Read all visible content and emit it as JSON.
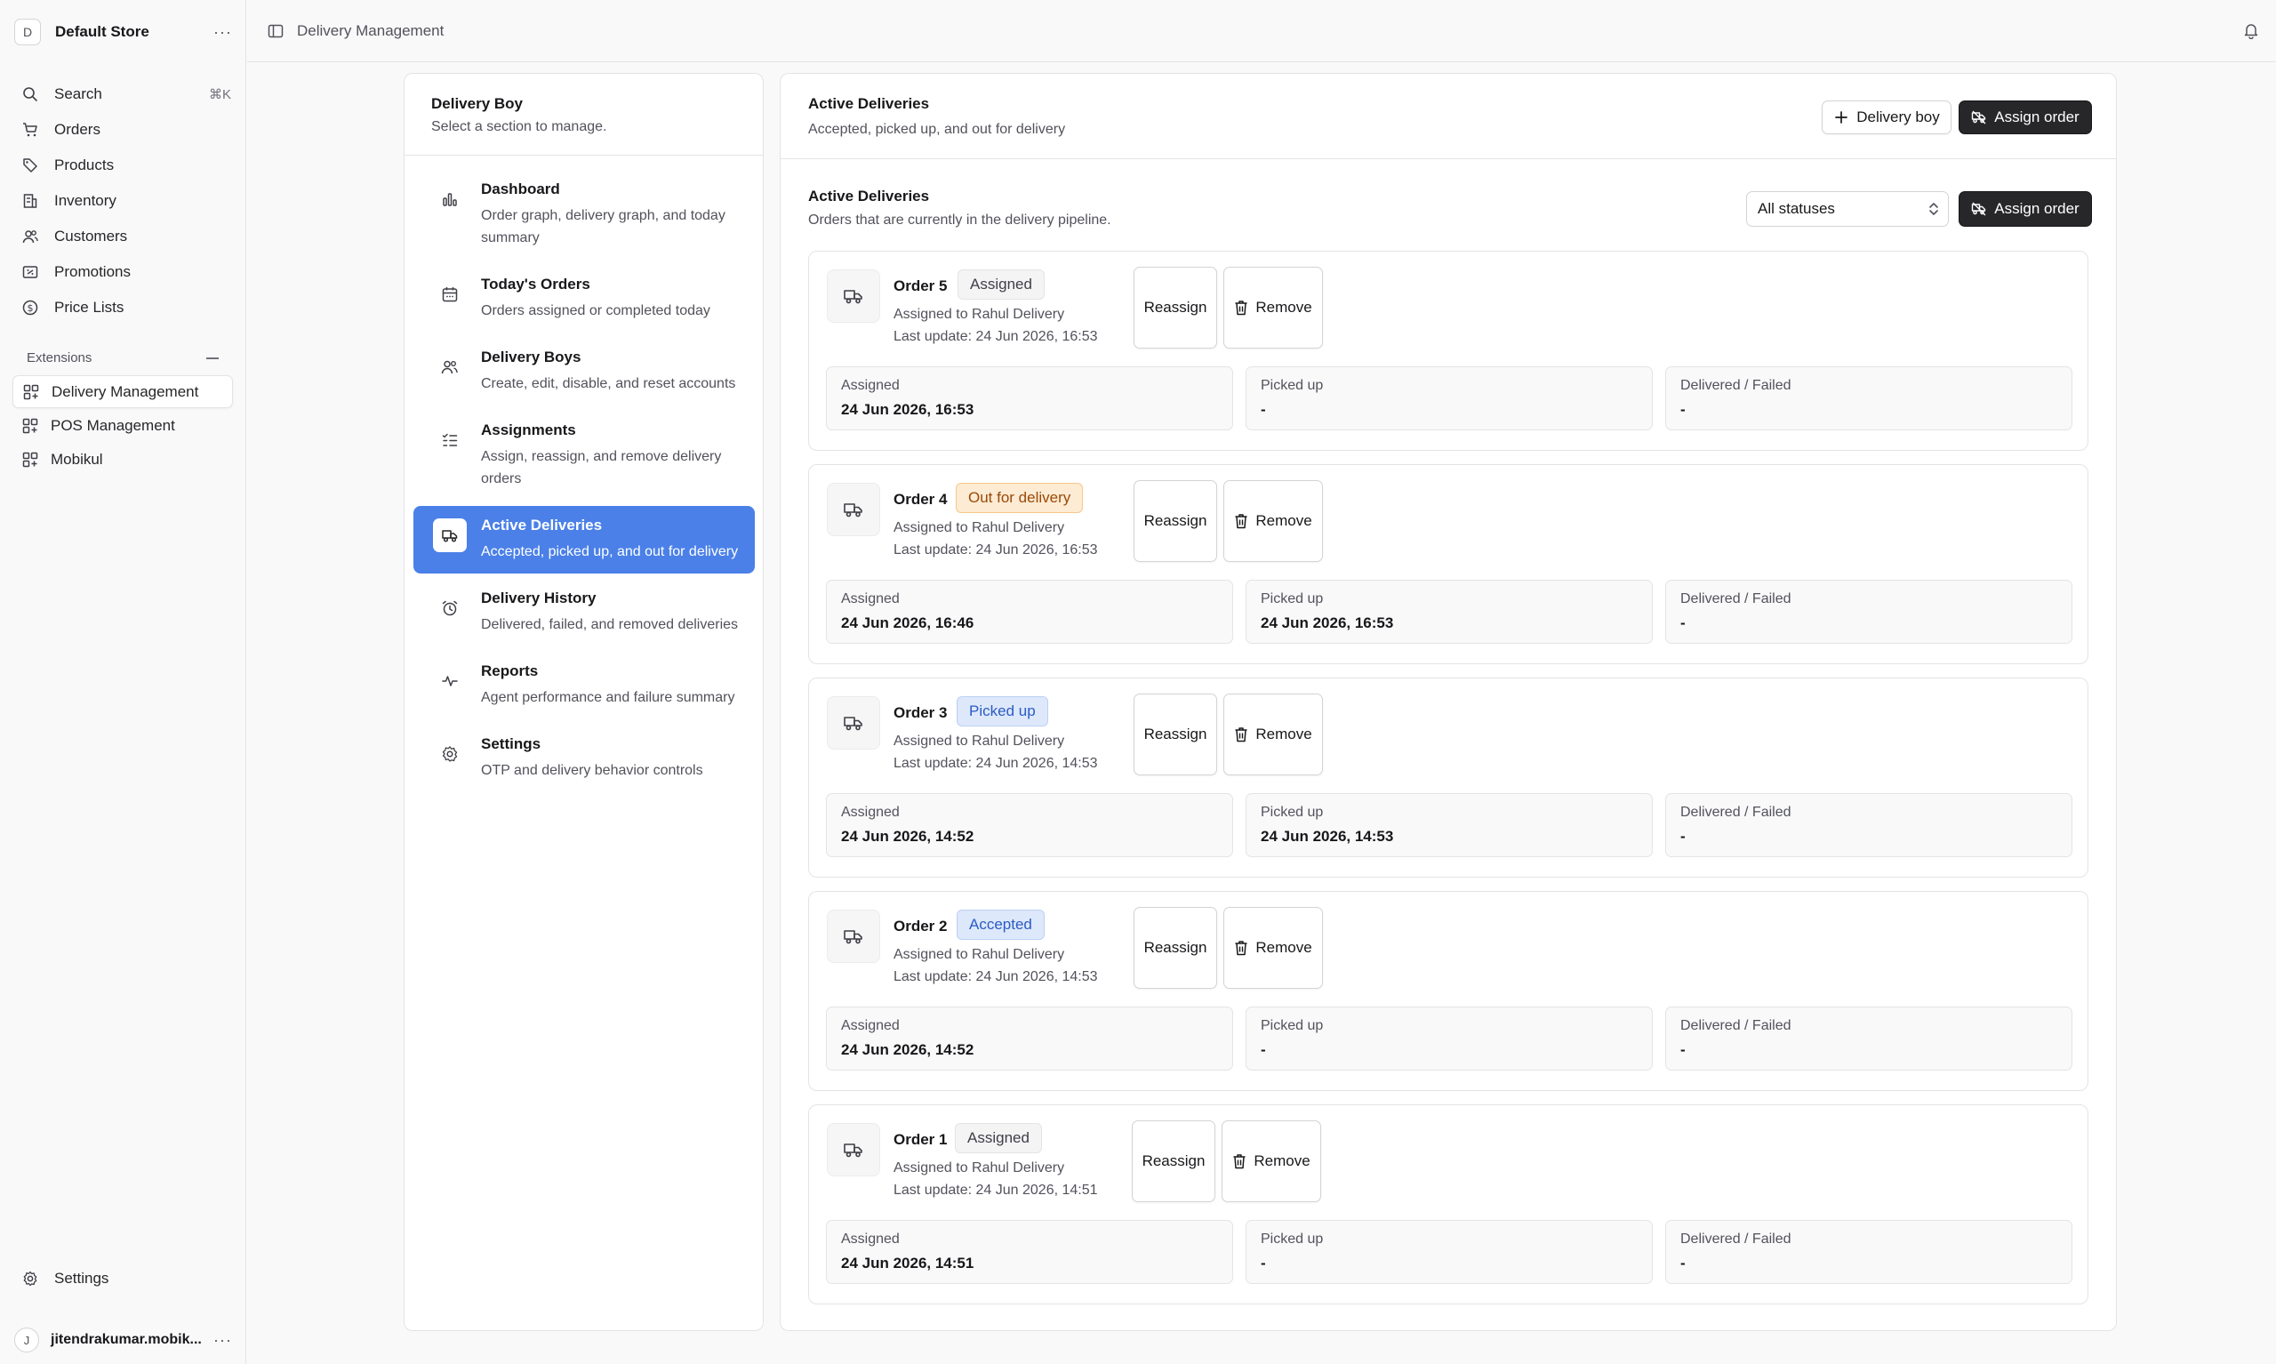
{
  "store": {
    "avatar": "D",
    "name": "Default Store"
  },
  "nav": [
    {
      "label": "Search",
      "shortcut": "⌘K",
      "icon": "search-icon"
    },
    {
      "label": "Orders",
      "icon": "cart-icon"
    },
    {
      "label": "Products",
      "icon": "tag-icon"
    },
    {
      "label": "Inventory",
      "icon": "building-icon"
    },
    {
      "label": "Customers",
      "icon": "users-icon"
    },
    {
      "label": "Promotions",
      "icon": "receipt-icon"
    },
    {
      "label": "Price Lists",
      "icon": "dollar-icon"
    }
  ],
  "extensions": {
    "header": "Extensions",
    "items": [
      {
        "label": "Delivery Management",
        "active": true
      },
      {
        "label": "POS Management"
      },
      {
        "label": "Mobikul"
      }
    ]
  },
  "sidebar_settings": "Settings",
  "user": {
    "avatar": "J",
    "name": "jitendrakumar.mobik..."
  },
  "topbar": {
    "breadcrumb": "Delivery Management"
  },
  "section": {
    "title": "Delivery Boy",
    "subtitle": "Select a section to manage.",
    "items": [
      {
        "title": "Dashboard",
        "desc": "Order graph, delivery graph, and today summary",
        "icon": "bar-chart-icon"
      },
      {
        "title": "Today's Orders",
        "desc": "Orders assigned or completed today",
        "icon": "calendar-icon"
      },
      {
        "title": "Delivery Boys",
        "desc": "Create, edit, disable, and reset accounts",
        "icon": "users-icon"
      },
      {
        "title": "Assignments",
        "desc": "Assign, reassign, and remove delivery orders",
        "icon": "checklist-icon"
      },
      {
        "title": "Active Deliveries",
        "desc": "Accepted, picked up, and out for delivery",
        "icon": "truck-icon",
        "active": true
      },
      {
        "title": "Delivery History",
        "desc": "Delivered, failed, and removed deliveries",
        "icon": "alarm-icon"
      },
      {
        "title": "Reports",
        "desc": "Agent performance and failure summary",
        "icon": "activity-icon"
      },
      {
        "title": "Settings",
        "desc": "OTP and delivery behavior controls",
        "icon": "gear-icon"
      }
    ]
  },
  "main": {
    "title": "Active Deliveries",
    "subtitle": "Accepted, picked up, and out for delivery",
    "delivery_boy_btn": "Delivery boy",
    "assign_order_btn": "Assign order",
    "list_title": "Active Deliveries",
    "list_subtitle": "Orders that are currently in the delivery pipeline.",
    "status_filter": "All statuses",
    "labels": {
      "reassign": "Reassign",
      "remove": "Remove",
      "assigned": "Assigned",
      "picked_up": "Picked up",
      "delivered_failed": "Delivered / Failed"
    },
    "orders": [
      {
        "name": "Order 5",
        "status": "Assigned",
        "assigned_to": "Assigned to Rahul Delivery",
        "last_update": "Last update: 24 Jun 2026, 16:53",
        "assigned_at": "24 Jun 2026, 16:53",
        "picked_up_at": "-",
        "delivered_at": "-"
      },
      {
        "name": "Order 4",
        "status": "Out for delivery",
        "assigned_to": "Assigned to Rahul Delivery",
        "last_update": "Last update: 24 Jun 2026, 16:53",
        "assigned_at": "24 Jun 2026, 16:46",
        "picked_up_at": "24 Jun 2026, 16:53",
        "delivered_at": "-"
      },
      {
        "name": "Order 3",
        "status": "Picked up",
        "assigned_to": "Assigned to Rahul Delivery",
        "last_update": "Last update: 24 Jun 2026, 14:53",
        "assigned_at": "24 Jun 2026, 14:52",
        "picked_up_at": "24 Jun 2026, 14:53",
        "delivered_at": "-"
      },
      {
        "name": "Order 2",
        "status": "Accepted",
        "assigned_to": "Assigned to Rahul Delivery",
        "last_update": "Last update: 24 Jun 2026, 14:53",
        "assigned_at": "24 Jun 2026, 14:52",
        "picked_up_at": "-",
        "delivered_at": "-"
      },
      {
        "name": "Order 1",
        "status": "Assigned",
        "assigned_to": "Assigned to Rahul Delivery",
        "last_update": "Last update: 24 Jun 2026, 14:51",
        "assigned_at": "24 Jun 2026, 14:51",
        "picked_up_at": "-",
        "delivered_at": "-"
      }
    ]
  },
  "colors": {
    "accent": "#4a80e8",
    "dark_button": "#27272a",
    "out_for_delivery": "#fdebd3",
    "picked_up": "#dde8fb"
  }
}
